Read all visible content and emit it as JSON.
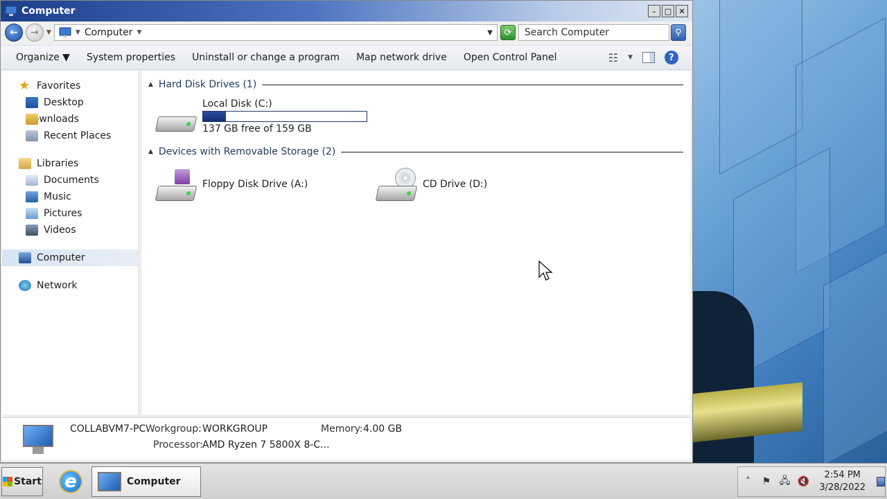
{
  "window": {
    "title": "Computer",
    "minimize": "–",
    "maximize": "□",
    "close": "✕"
  },
  "address": {
    "path": "Computer",
    "search_placeholder": "Search Computer"
  },
  "toolbar": {
    "organize": "Organize",
    "system_properties": "System properties",
    "uninstall": "Uninstall or change a program",
    "map_network": "Map network drive",
    "open_control_panel": "Open Control Panel",
    "help": "?"
  },
  "nav": {
    "favorites": {
      "label": "Favorites",
      "items": [
        "Desktop",
        "Downloads",
        "Recent Places"
      ]
    },
    "libraries": {
      "label": "Libraries",
      "items": [
        "Documents",
        "Music",
        "Pictures",
        "Videos"
      ]
    },
    "computer": "Computer",
    "network": "Network"
  },
  "content": {
    "hard_disk_header": "Hard Disk Drives (1)",
    "removable_header": "Devices with Removable Storage (2)",
    "local_disk": {
      "name": "Local Disk (C:)",
      "free_text": "137 GB free of 159 GB",
      "used_fraction": 0.14
    },
    "floppy": "Floppy Disk Drive (A:)",
    "cd": "CD Drive (D:)"
  },
  "details": {
    "computer_name": "COLLABVM7-PC",
    "workgroup_label": "Workgroup:",
    "workgroup_value": "WORKGROUP",
    "memory_label": "Memory:",
    "memory_value": "4.00 GB",
    "processor_label": "Processor:",
    "processor_value": "AMD Ryzen 7 5800X 8-C..."
  },
  "taskbar": {
    "start": "Start",
    "active_window": "Computer",
    "time": "2:54 PM",
    "date": "3/28/2022"
  }
}
